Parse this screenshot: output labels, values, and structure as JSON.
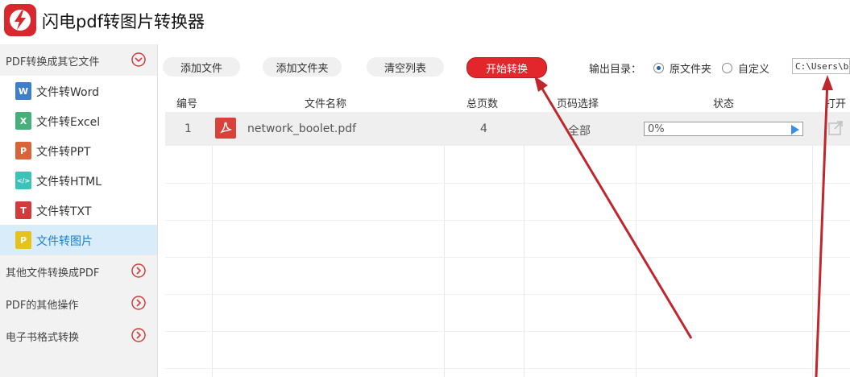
{
  "app": {
    "title": "闪电pdf转图片转换器"
  },
  "sidebar": {
    "groups": [
      {
        "label": "PDF转换成其它文件",
        "expanded": true
      },
      {
        "label": "其他文件转换成PDF",
        "expanded": false
      },
      {
        "label": "PDF的其他操作",
        "expanded": false
      },
      {
        "label": "电子书格式转换",
        "expanded": false
      }
    ],
    "items": [
      {
        "label": "文件转Word",
        "icon_text": "W",
        "icon": "word-icon",
        "color": "#3f7fca"
      },
      {
        "label": "文件转Excel",
        "icon_text": "X",
        "icon": "excel-icon",
        "color": "#46b07a"
      },
      {
        "label": "文件转PPT",
        "icon_text": "P",
        "icon": "ppt-icon",
        "color": "#d8643a"
      },
      {
        "label": "文件转HTML",
        "icon_text": "</>",
        "icon": "html-icon",
        "color": "#3bc3b8"
      },
      {
        "label": "文件转TXT",
        "icon_text": "T",
        "icon": "txt-icon",
        "color": "#d23b3b"
      },
      {
        "label": "文件转图片",
        "icon_text": "P",
        "icon": "image-icon",
        "color": "#e6c21d",
        "active": true
      }
    ]
  },
  "toolbar": {
    "add_file": "添加文件",
    "add_folder": "添加文件夹",
    "clear_list": "清空列表",
    "start": "开始转换",
    "output_label": "输出目录：",
    "option_original": "原文件夹",
    "option_custom": "自定义",
    "selected_option": "原文件夹",
    "path": "C:\\Users\\bkid"
  },
  "table": {
    "headers": [
      "编号",
      "文件名称",
      "总页数",
      "页码选择",
      "状态",
      "打开"
    ],
    "rows": [
      {
        "index": "1",
        "filename": "network_boolet.pdf",
        "pages": "4",
        "page_select": "全部",
        "status": "0%",
        "progress": 0
      }
    ]
  },
  "colors": {
    "accent": "#e2262c",
    "active_bg": "#d8ecf9",
    "active_text": "#1c7fd1",
    "annotation_arrow": "#c0272d"
  }
}
